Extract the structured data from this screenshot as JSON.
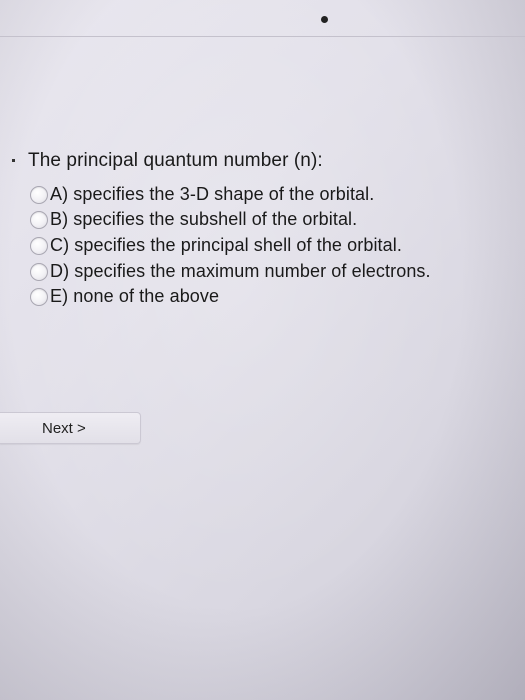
{
  "question": {
    "text": "The principal quantum number (n):"
  },
  "options": [
    {
      "label": "A) specifies the 3-D shape of the orbital."
    },
    {
      "label": "B) specifies the subshell of the orbital."
    },
    {
      "label": "C) specifies the principal shell of the orbital."
    },
    {
      "label": "D) specifies the maximum number of electrons."
    },
    {
      "label": "E) none of the above"
    }
  ],
  "navigation": {
    "next_label": "Next >"
  }
}
